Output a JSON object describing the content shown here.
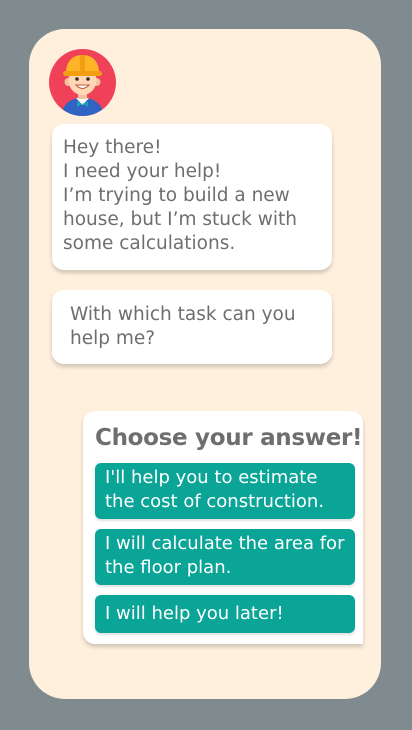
{
  "avatar": {
    "icon": "construction-worker-icon",
    "background": "#ef4259"
  },
  "messages": [
    {
      "text": "Hey there!\nI need your help!\nI’m trying to build a new house, but I’m stuck with some calculations."
    },
    {
      "text": "With which task can you help me?"
    }
  ],
  "answers": {
    "title": "Choose your answer!",
    "options": [
      {
        "label": "I'll help you to estimate the cost of construction."
      },
      {
        "label": "I will calculate the area for the floor plan."
      },
      {
        "label": "I will help you later!"
      }
    ]
  },
  "colors": {
    "backdrop": "#808b8f",
    "panel": "#fff0dd",
    "accent": "#0aa597",
    "text": "#6e6e6e"
  }
}
